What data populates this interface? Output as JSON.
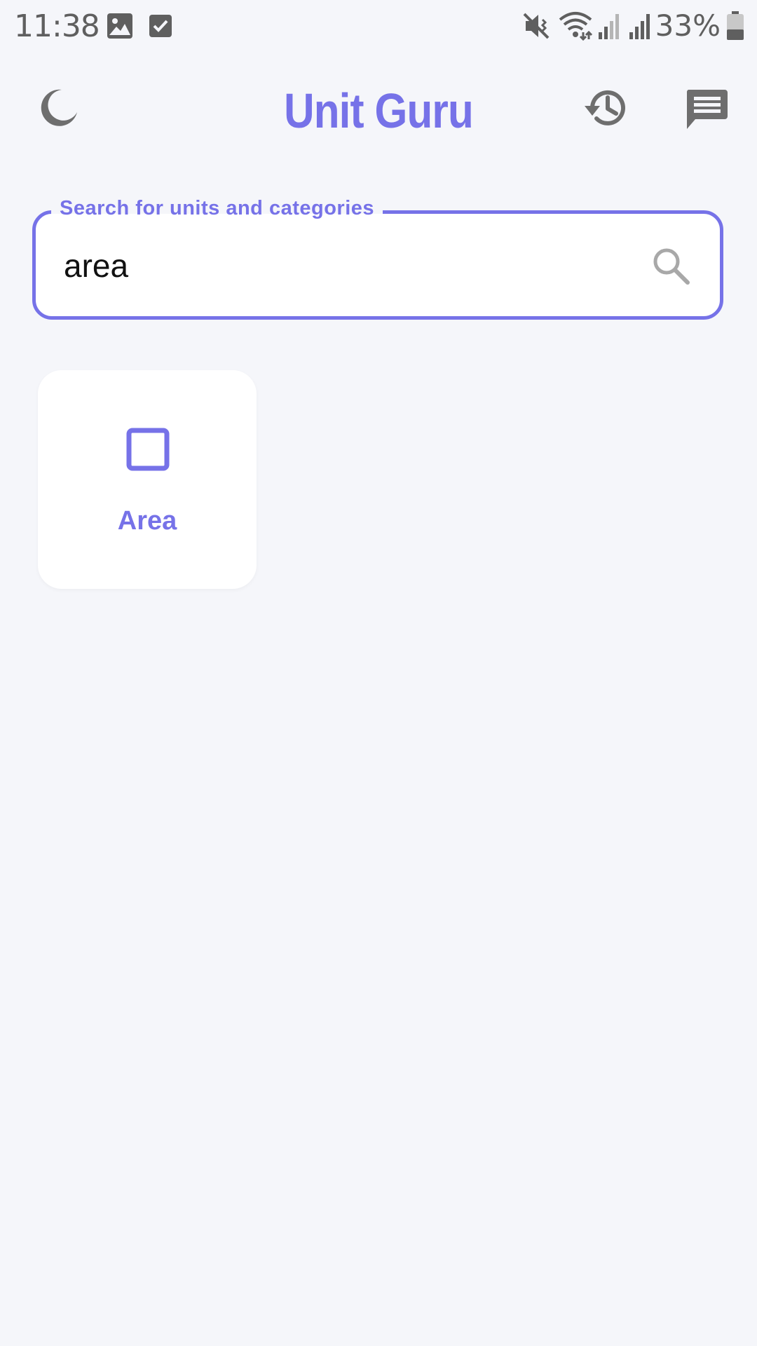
{
  "status_bar": {
    "time": "11:38",
    "battery_percent": "33%",
    "icons": [
      "image-icon",
      "checkbox-icon",
      "mute-icon",
      "wifi-icon",
      "signal-icon",
      "signal-icon",
      "battery-icon"
    ]
  },
  "app_bar": {
    "title": "Unit Guru",
    "left_icon": "moon-icon",
    "right_icons": [
      "history-icon",
      "feedback-icon"
    ]
  },
  "search": {
    "label": "Search for units and categories",
    "value": "area",
    "icon": "search-icon"
  },
  "results": [
    {
      "label": "Area",
      "icon": "square-outline-icon"
    }
  ],
  "colors": {
    "accent": "#7672e8",
    "background": "#f5f6fa",
    "card": "#ffffff",
    "icon_gray": "#6e6e6e"
  }
}
